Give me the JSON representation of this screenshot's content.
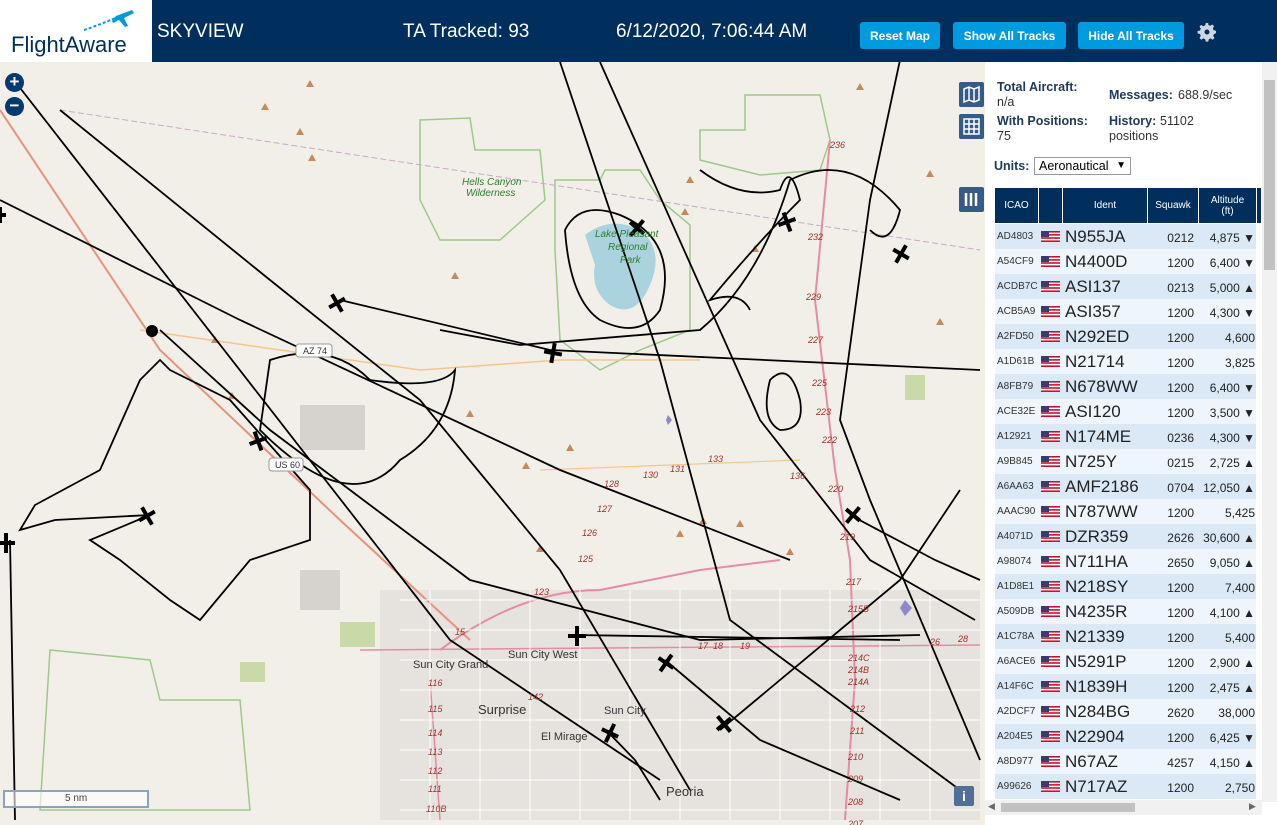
{
  "header": {
    "logo_text": "FlightAware",
    "app_title": "SKYVIEW",
    "tracked": "TA Tracked: 93",
    "datetime": "6/12/2020, 7:06:44 AM",
    "reset_label": "Reset Map",
    "show_label": "Show All Tracks",
    "hide_label": "Hide All Tracks",
    "settings_icon": "gear-icon"
  },
  "map": {
    "labels": {
      "hells_canyon_1": "Hells Canyon",
      "hells_canyon_2": "Wilderness",
      "lake_1": "Lake Pleasant",
      "lake_2": "Regional",
      "lake_3": "Park",
      "az74": "AZ 74",
      "us60": "US 60",
      "sun_city_grand": "Sun City Grand",
      "sun_city_west": "Sun City West",
      "surprise": "Surprise",
      "sun_city": "Sun City",
      "el_mirage": "El Mirage",
      "peoria": "Peoria"
    },
    "route_numbers": [
      "236",
      "232",
      "229",
      "227",
      "225",
      "223",
      "222",
      "220",
      "219",
      "217",
      "215B",
      "214C",
      "214B",
      "214A",
      "212",
      "211",
      "210",
      "209",
      "208",
      "207",
      "131",
      "130",
      "133",
      "128",
      "127",
      "126",
      "125",
      "123",
      "18",
      "17",
      "19",
      "26",
      "28",
      "15",
      "116",
      "115",
      "114",
      "113",
      "112",
      "111",
      "110B",
      "142",
      "136"
    ],
    "scale_label": "5 nm",
    "zoom_in": "+",
    "zoom_out": "−",
    "info": "i"
  },
  "stats": {
    "total_label": "Total Aircraft:",
    "total_value": "n/a",
    "positions_label": "With Positions:",
    "positions_value": "75",
    "messages_label": "Messages:",
    "messages_value": "688.9/sec",
    "history_label": "History:",
    "history_value": "51102",
    "history_unit": "positions",
    "units_label": "Units:",
    "units_value": "Aeronautical"
  },
  "table": {
    "headers": {
      "icao": "ICAO",
      "ident": "Ident",
      "squawk": "Squawk",
      "altitude": "Altitude",
      "altitude_unit": "(ft)"
    },
    "rows": [
      {
        "icao": "AD4803",
        "ident": "N955JA",
        "squawk": "0212",
        "alt": "4,875 ▼"
      },
      {
        "icao": "A54CF9",
        "ident": "N4400D",
        "squawk": "1200",
        "alt": "6,400 ▼"
      },
      {
        "icao": "ACDB7C",
        "ident": "ASI137",
        "squawk": "0213",
        "alt": "5,000 ▲"
      },
      {
        "icao": "ACB5A9",
        "ident": "ASI357",
        "squawk": "1200",
        "alt": "4,300 ▼"
      },
      {
        "icao": "A2FD50",
        "ident": "N292ED",
        "squawk": "1200",
        "alt": "4,600"
      },
      {
        "icao": "A1D61B",
        "ident": "N21714",
        "squawk": "1200",
        "alt": "3,825"
      },
      {
        "icao": "A8FB79",
        "ident": "N678WW",
        "squawk": "1200",
        "alt": "6,400 ▼"
      },
      {
        "icao": "ACE32E",
        "ident": "ASI120",
        "squawk": "1200",
        "alt": "3,500 ▼"
      },
      {
        "icao": "A12921",
        "ident": "N174ME",
        "squawk": "0236",
        "alt": "4,300 ▼"
      },
      {
        "icao": "A9B845",
        "ident": "N725Y",
        "squawk": "0215",
        "alt": "2,725 ▲"
      },
      {
        "icao": "A6AA63",
        "ident": "AMF2186",
        "squawk": "0704",
        "alt": "12,050 ▲"
      },
      {
        "icao": "AAAC90",
        "ident": "N787WW",
        "squawk": "1200",
        "alt": "5,425"
      },
      {
        "icao": "A4071D",
        "ident": "DZR359",
        "squawk": "2626",
        "alt": "30,600 ▲"
      },
      {
        "icao": "A98074",
        "ident": "N711HA",
        "squawk": "2650",
        "alt": "9,050 ▲"
      },
      {
        "icao": "A1D8E1",
        "ident": "N218SY",
        "squawk": "1200",
        "alt": "7,400"
      },
      {
        "icao": "A509DB",
        "ident": "N4235R",
        "squawk": "1200",
        "alt": "4,100 ▲"
      },
      {
        "icao": "A1C78A",
        "ident": "N21339",
        "squawk": "1200",
        "alt": "5,400"
      },
      {
        "icao": "A6ACE6",
        "ident": "N5291P",
        "squawk": "1200",
        "alt": "2,900 ▲"
      },
      {
        "icao": "A14F6C",
        "ident": "N1839H",
        "squawk": "1200",
        "alt": "2,475 ▲"
      },
      {
        "icao": "A2DCF7",
        "ident": "N284BG",
        "squawk": "2620",
        "alt": "38,000"
      },
      {
        "icao": "A204E5",
        "ident": "N22904",
        "squawk": "1200",
        "alt": "6,425 ▼"
      },
      {
        "icao": "A8D977",
        "ident": "N67AZ",
        "squawk": "4257",
        "alt": "4,150 ▲"
      },
      {
        "icao": "A99626",
        "ident": "N717AZ",
        "squawk": "1200",
        "alt": "2,750"
      }
    ]
  },
  "colors": {
    "header_bg": "#002f5d",
    "button_bg": "#009bde",
    "table_header": "#002f5d",
    "row_even": "#dbe9f7",
    "row_odd": "#eef5fc"
  }
}
